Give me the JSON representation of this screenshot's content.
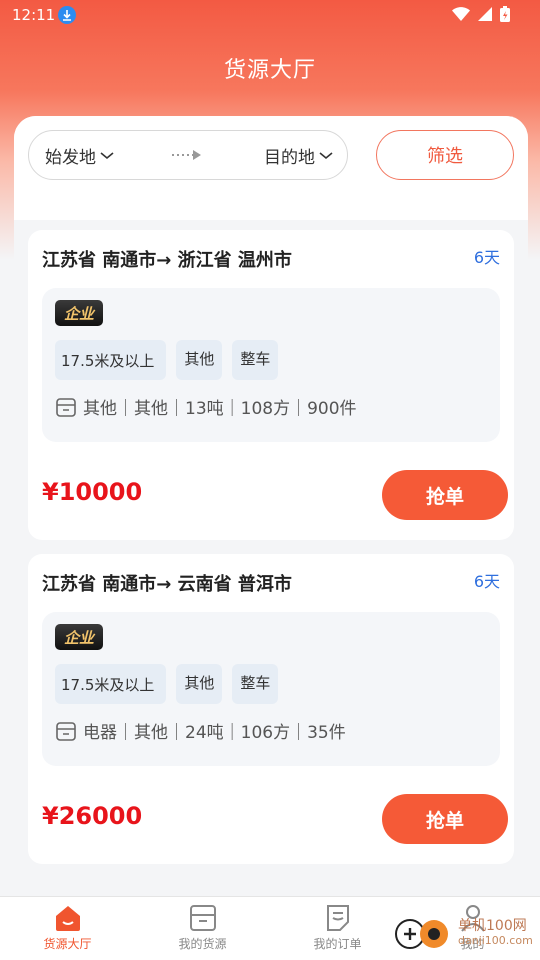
{
  "status_bar": {
    "time": "12:11"
  },
  "header": {
    "title": "货源大厅"
  },
  "route_filter": {
    "origin": "始发地",
    "destination": "目的地",
    "filter_label": "筛选"
  },
  "cards": [
    {
      "route": "江苏省 南通市→ 浙江省 温州市",
      "days": "6天",
      "badge": "企业",
      "tags": [
        "17.5米及以上",
        "其他",
        "整车"
      ],
      "cargo": "其他｜其他｜13吨｜108方｜900件",
      "price": "¥10000",
      "action": "抢单"
    },
    {
      "route": "江苏省 南通市→ 云南省 普洱市",
      "days": "6天",
      "badge": "企业",
      "tags": [
        "17.5米及以上",
        "其他",
        "整车"
      ],
      "cargo": "电器｜其他｜24吨｜106方｜35件",
      "price": "¥26000",
      "action": "抢单"
    }
  ],
  "tabbar": {
    "items": [
      {
        "label": "货源大厅",
        "icon": "home-icon"
      },
      {
        "label": "我的货源",
        "icon": "box-icon"
      },
      {
        "label": "我的订单",
        "icon": "order-icon"
      },
      {
        "label": "我的",
        "icon": "person-icon"
      }
    ]
  },
  "watermark": {
    "text": "单机100网",
    "url": "danji100.com"
  },
  "colors": {
    "accent": "#f55a37",
    "price": "#e8141b",
    "days": "#2f6fde"
  }
}
